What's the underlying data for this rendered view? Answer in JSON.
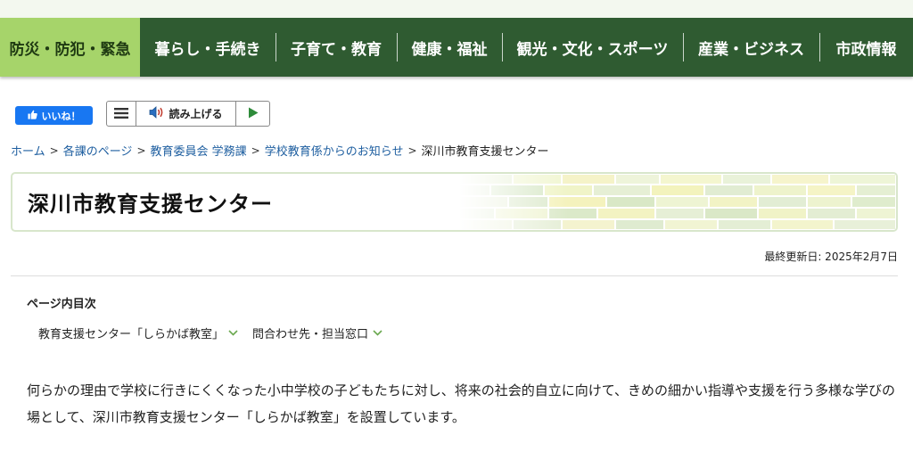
{
  "nav": {
    "items": [
      {
        "label": "防災・防犯・緊急"
      },
      {
        "label": "暮らし・手続き"
      },
      {
        "label": "子育て・教育"
      },
      {
        "label": "健康・福祉"
      },
      {
        "label": "観光・文化・スポーツ"
      },
      {
        "label": "産業・ビジネス"
      },
      {
        "label": "市政情報"
      }
    ]
  },
  "social": {
    "like_label": "いいね！"
  },
  "reader": {
    "read_label": "読み上げる"
  },
  "breadcrumb": {
    "items": [
      "ホーム",
      "各課のページ",
      "教育委員会 学務課",
      "学校教育係からのお知らせ"
    ],
    "current": "深川市教育支援センター"
  },
  "page": {
    "title": "深川市教育支援センター",
    "updated": "最終更新日: 2025年2月7日"
  },
  "toc": {
    "heading": "ページ内目次",
    "links": [
      "教育支援センター「しらかば教室」",
      "問合わせ先・担当窓口"
    ]
  },
  "content": {
    "intro": "何らかの理由で学校に行きにくくなった小中学校の子どもたちに対し、将来の社会的自立に向けて、きめの細かい指導や支援を行う多様な学びの場として、深川市教育支援センター「しらかば教室」を設置しています。"
  },
  "colors": {
    "nav_bg": "#2f5b31",
    "nav_active": "#a6d46a",
    "link": "#1f5fa0",
    "like_button": "#1877f2"
  }
}
